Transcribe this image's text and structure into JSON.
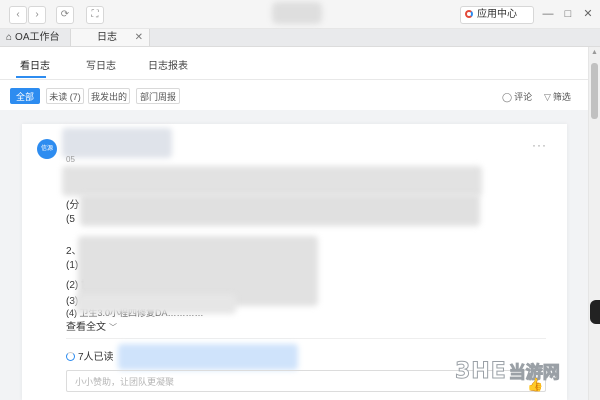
{
  "titlebar": {
    "back_icon": "‹",
    "forward_icon": "›",
    "refresh_icon": "⟳",
    "fullscreen_icon": "⛶",
    "app_center_label": "应用中心",
    "minimize_icon": "—",
    "maximize_icon": "□",
    "close_icon": "✕"
  },
  "tabs": [
    {
      "label": "OA工作台",
      "icon": "home-icon"
    },
    {
      "label": "日志",
      "close": "✕"
    }
  ],
  "subnav": {
    "items": [
      "看日志",
      "写日志",
      "日志报表"
    ],
    "active": "看日志"
  },
  "filters": {
    "chips": [
      "全部",
      "未读 (7)",
      "我发出的",
      "部门周报"
    ],
    "active": "全部",
    "comment_label": "评论",
    "filter_label": "筛选"
  },
  "post": {
    "avatar_text": "信源",
    "more": "···",
    "date_prefix": "05",
    "lines": [
      "(分",
      "(5",
      "2、",
      "(1)",
      "(2) 协",
      "(3) 针",
      "(4) 卫生3.0小程四修复DA…………"
    ],
    "view_full": "查看全文",
    "readers_label": "7人已读",
    "comment_placeholder": "小小赞助，让团队更凝聚"
  },
  "watermark": {
    "brand": "3HE",
    "site": "当游网"
  },
  "colors": {
    "accent": "#2d8cf0",
    "background": "#f2f3f5"
  }
}
